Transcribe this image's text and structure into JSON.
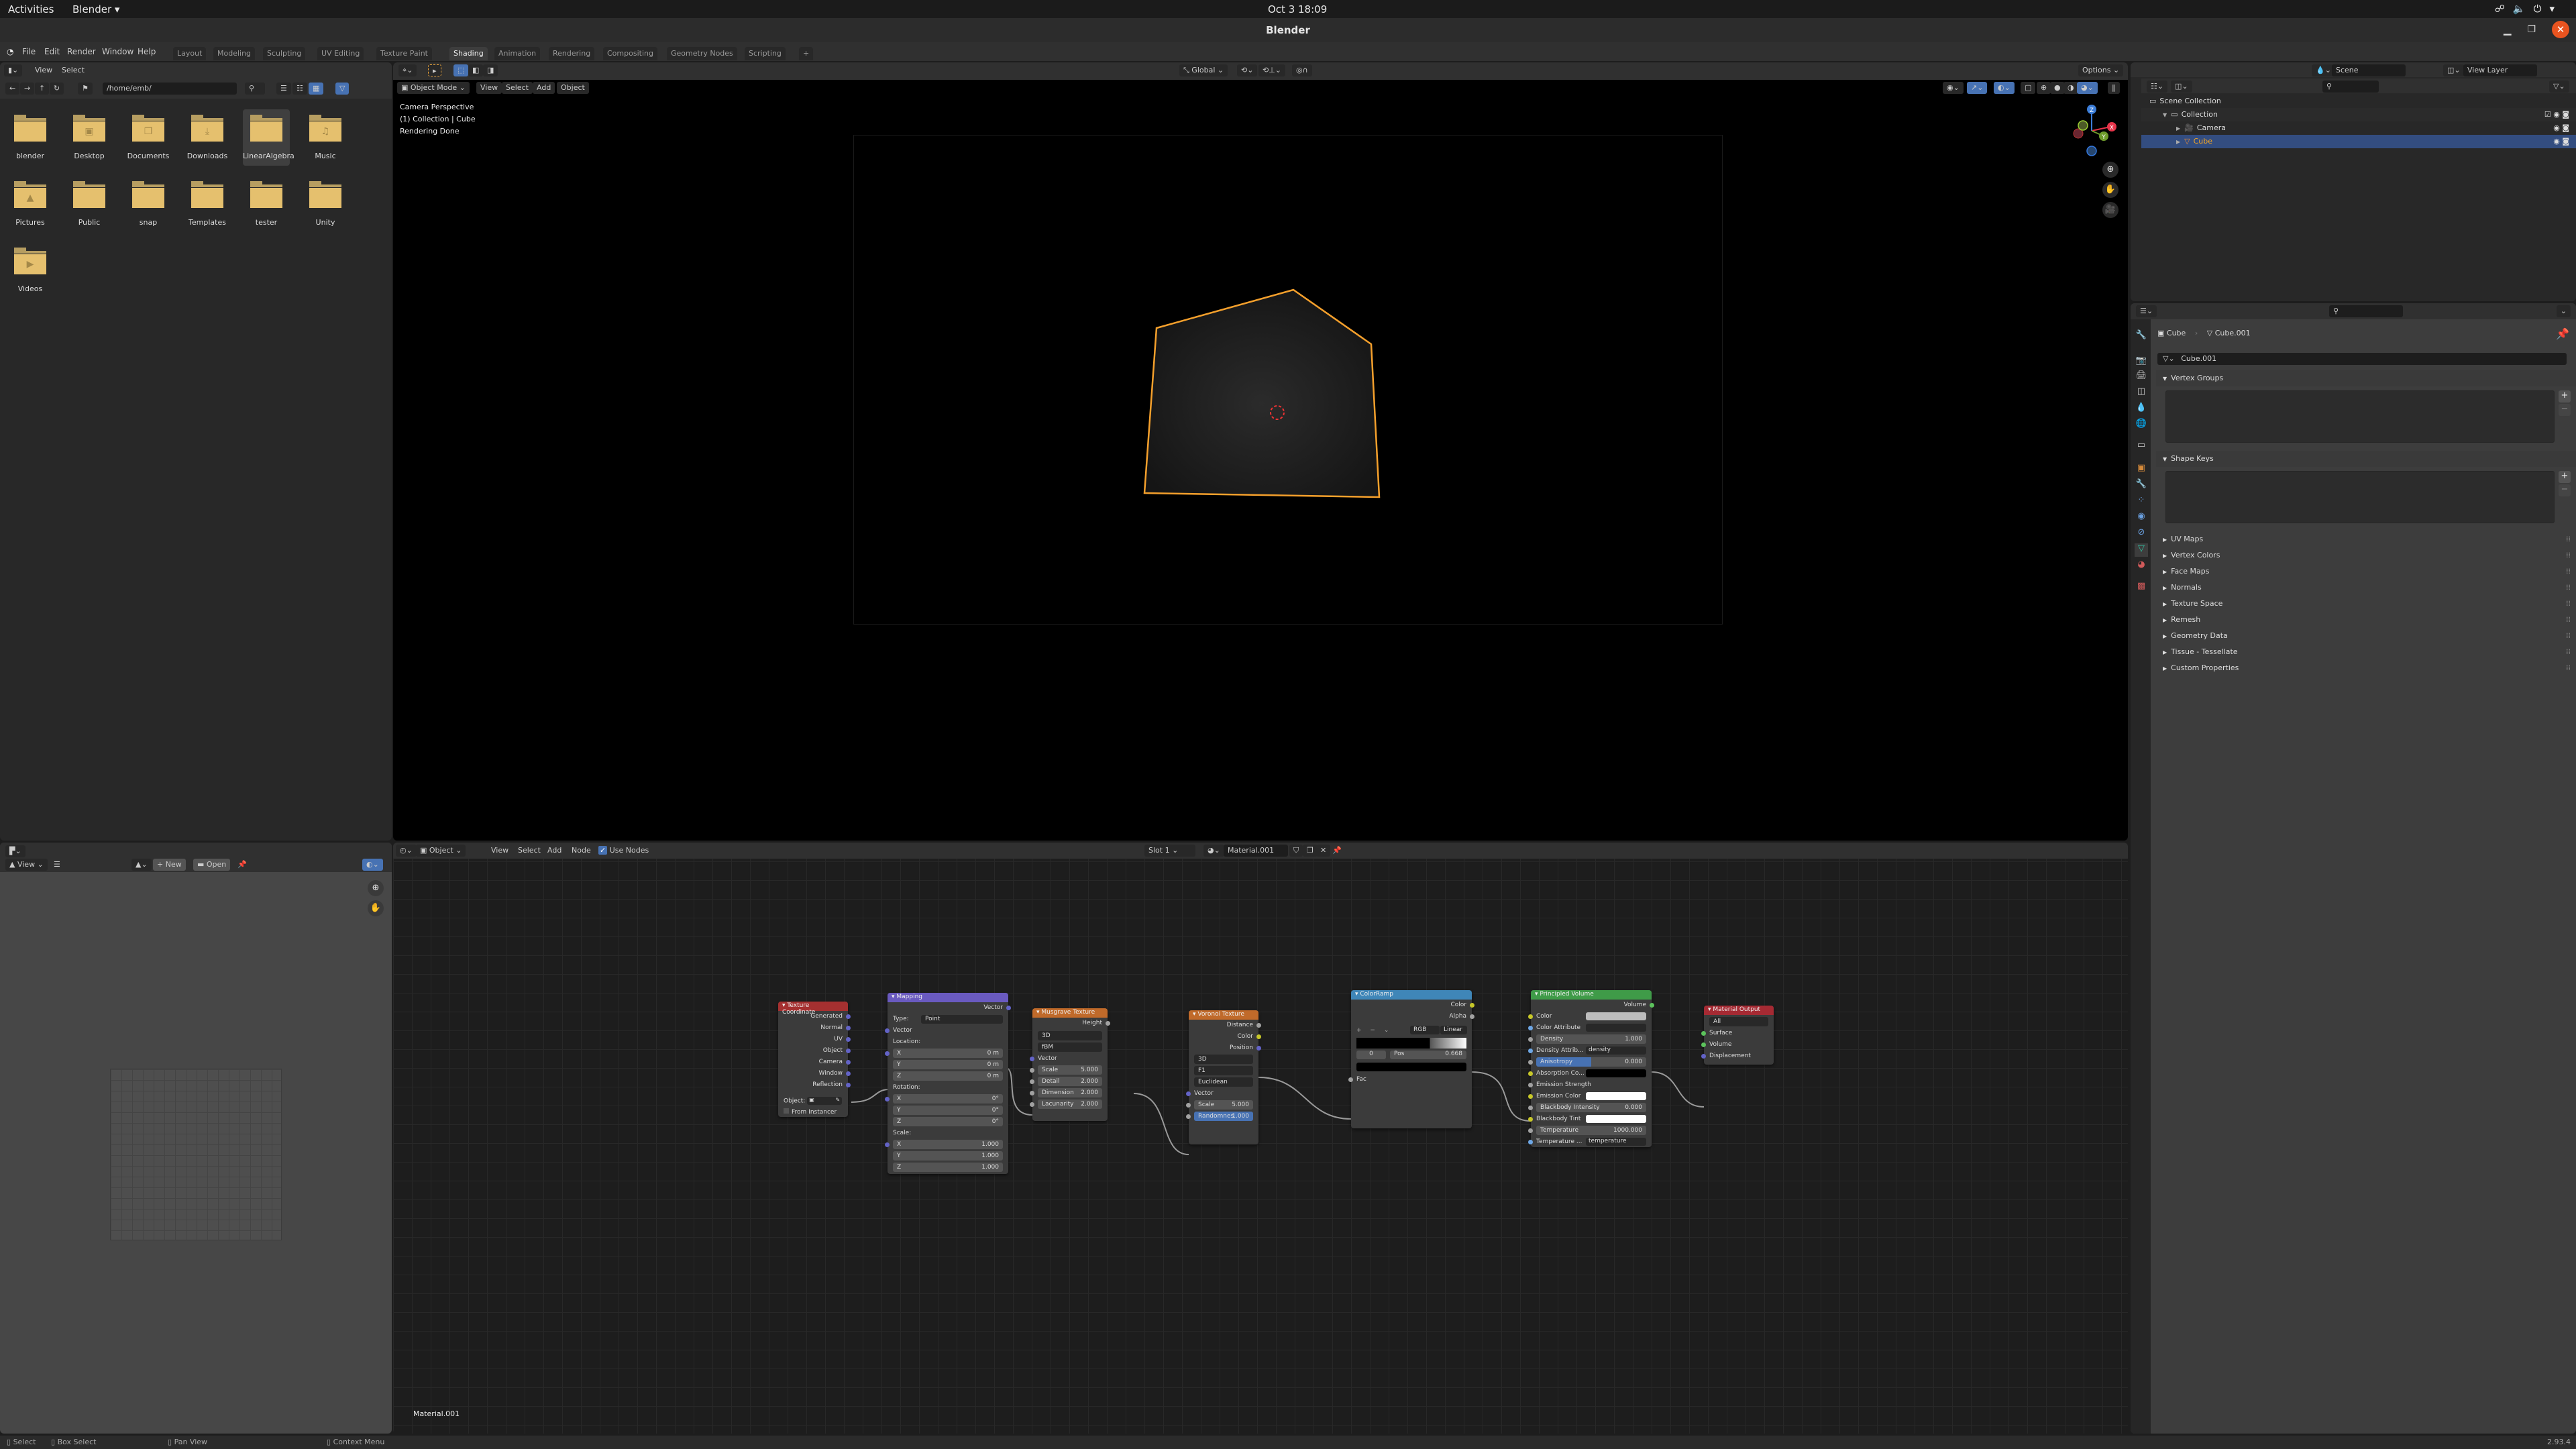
{
  "gnome": {
    "activities": "Activities",
    "app_menu": "Blender ▾",
    "clock": "Oct 3  18:09",
    "tray_icons": [
      "network-icon",
      "volume-icon",
      "power-icon",
      "menu-arrow-icon"
    ]
  },
  "window": {
    "title": "Blender"
  },
  "menu": {
    "items": [
      "File",
      "Edit",
      "Render",
      "Window",
      "Help"
    ],
    "workspaces": [
      "Layout",
      "Modeling",
      "Sculpting",
      "UV Editing",
      "Texture Paint",
      "Shading",
      "Animation",
      "Rendering",
      "Compositing",
      "Geometry Nodes",
      "Scripting",
      "+"
    ],
    "active_workspace": "Shading"
  },
  "file_browser": {
    "menu": [
      "View",
      "Select"
    ],
    "path": "/home/emb/",
    "folders": [
      {
        "name": "blender",
        "icon": ""
      },
      {
        "name": "Desktop",
        "icon": "▣"
      },
      {
        "name": "Documents",
        "icon": "❐"
      },
      {
        "name": "Downloads",
        "icon": "⤓"
      },
      {
        "name": "LinearAlgebra",
        "icon": "",
        "selected": true
      },
      {
        "name": "Music",
        "icon": "♫"
      },
      {
        "name": "Pictures",
        "icon": "▲"
      },
      {
        "name": "Public",
        "icon": ""
      },
      {
        "name": "snap",
        "icon": ""
      },
      {
        "name": "Templates",
        "icon": ""
      },
      {
        "name": "tester",
        "icon": ""
      },
      {
        "name": "Unity",
        "icon": ""
      },
      {
        "name": "Videos",
        "icon": "▶"
      }
    ]
  },
  "viewport": {
    "mode": "Object Mode",
    "menu": [
      "View",
      "Select",
      "Add",
      "Object"
    ],
    "orientation": "Global",
    "options": "Options",
    "overlay_lines": [
      "Camera Perspective",
      "(1) Collection | Cube",
      "Rendering Done"
    ],
    "gizmo_axes": [
      "Z",
      "X",
      "Y"
    ]
  },
  "outliner": {
    "scene": "Scene",
    "view_layer": "View Layer",
    "items": [
      {
        "label": "Scene Collection",
        "depth": 0
      },
      {
        "label": "Collection",
        "depth": 1
      },
      {
        "label": "Camera",
        "depth": 2
      },
      {
        "label": "Cube",
        "depth": 2,
        "selected": true
      }
    ]
  },
  "properties": {
    "breadcrumb": [
      "Cube",
      "Cube.001"
    ],
    "mesh_name": "Cube.001",
    "panels_open": [
      "Vertex Groups",
      "Shape Keys"
    ],
    "panels_closed": [
      "UV Maps",
      "Vertex Colors",
      "Face Maps",
      "Normals",
      "Texture Space",
      "Remesh",
      "Geometry Data",
      "Tissue - Tessellate",
      "Custom Properties"
    ]
  },
  "image_editor": {
    "view": "View",
    "new": "New",
    "open": "Open"
  },
  "node_editor": {
    "object": "Object",
    "menu": [
      "View",
      "Select",
      "Add",
      "Node"
    ],
    "use_nodes": "Use Nodes",
    "slot": "Slot 1",
    "material": "Material.001",
    "footer_label": "Material.001",
    "nodes": {
      "texcoord": {
        "title": "Texture Coordinate",
        "outputs": [
          "Generated",
          "Normal",
          "UV",
          "Object",
          "Camera",
          "Window",
          "Reflection"
        ],
        "object_label": "Object:",
        "from_instancer": "From Instancer"
      },
      "mapping": {
        "title": "Mapping",
        "output": "Vector",
        "type_label": "Type:",
        "type_value": "Point",
        "vector_in": "Vector",
        "location_label": "Location:",
        "location": [
          [
            "X",
            "0 m"
          ],
          [
            "Y",
            "0 m"
          ],
          [
            "Z",
            "0 m"
          ]
        ],
        "rotation_label": "Rotation:",
        "rotation": [
          [
            "X",
            "0°"
          ],
          [
            "Y",
            "0°"
          ],
          [
            "Z",
            "0°"
          ]
        ],
        "scale_label": "Scale:",
        "scale": [
          [
            "X",
            "1.000"
          ],
          [
            "Y",
            "1.000"
          ],
          [
            "Z",
            "1.000"
          ]
        ]
      },
      "musgrave": {
        "title": "Musgrave Texture",
        "output": "Height",
        "dim": "3D",
        "type": "fBM",
        "vector_in": "Vector",
        "fields": [
          [
            "Scale",
            "5.000"
          ],
          [
            "Detail",
            "2.000"
          ],
          [
            "Dimension",
            "2.000"
          ],
          [
            "Lacunarity",
            "2.000"
          ]
        ]
      },
      "voronoi": {
        "title": "Voronoi Texture",
        "outputs": [
          "Distance",
          "Color",
          "Position"
        ],
        "dropdowns": [
          "3D",
          "F1",
          "Euclidean"
        ],
        "vector_in": "Vector",
        "fields": [
          [
            "Scale",
            "5.000"
          ],
          [
            "Randomnes",
            "1.000"
          ]
        ]
      },
      "colorramp": {
        "title": "ColorRamp",
        "outputs": [
          "Color",
          "Alpha"
        ],
        "mode": "RGB",
        "interp": "Linear",
        "stop_index": "0",
        "pos_label": "Pos",
        "pos_value": "0.668",
        "input": "Fac"
      },
      "volume": {
        "title": "Principled Volume",
        "output": "Volume",
        "rows": [
          {
            "label": "Color",
            "kind": "color",
            "color": "#bdbdbd",
            "sock": "#c7c729"
          },
          {
            "label": "Color Attribute",
            "kind": "text",
            "value": "",
            "sock": "#6ea7e5"
          },
          {
            "label": "Density",
            "kind": "num",
            "value": "1.000",
            "sock": "#a1a1a1"
          },
          {
            "label": "Density Attrib...",
            "kind": "text",
            "value": "density",
            "sock": "#6ea7e5"
          },
          {
            "label": "Anisotropy",
            "kind": "slider",
            "value": "0.000",
            "sock": "#a1a1a1"
          },
          {
            "label": "Absorption Co...",
            "kind": "color",
            "color": "#000000",
            "sock": "#c7c729"
          },
          {
            "label": "Emission Strength",
            "kind": "plain",
            "sock": "#a1a1a1"
          },
          {
            "label": "Emission Color",
            "kind": "color",
            "color": "#ffffff",
            "sock": "#c7c729"
          },
          {
            "label": "Blackbody Intensity",
            "kind": "num",
            "value": "0.000",
            "sock": "#a1a1a1"
          },
          {
            "label": "Blackbody Tint",
            "kind": "color",
            "color": "#ffffff",
            "sock": "#c7c729"
          },
          {
            "label": "Temperature",
            "kind": "num",
            "value": "1000.000",
            "sock": "#a1a1a1"
          },
          {
            "label": "Temperature ...",
            "kind": "text",
            "value": "temperature",
            "sock": "#6ea7e5"
          }
        ]
      },
      "output": {
        "title": "Material Output",
        "target": "All",
        "inputs": [
          "Surface",
          "Volume",
          "Displacement"
        ]
      }
    }
  },
  "status_bar": {
    "hints": [
      "Select",
      "Box Select",
      "Pan View",
      "Context Menu"
    ],
    "version": "2.93.4"
  },
  "colors": {
    "accent_blue": "#4772b3",
    "selection_orange": "#f5a623",
    "folder_yellow": "#e5c06e"
  }
}
